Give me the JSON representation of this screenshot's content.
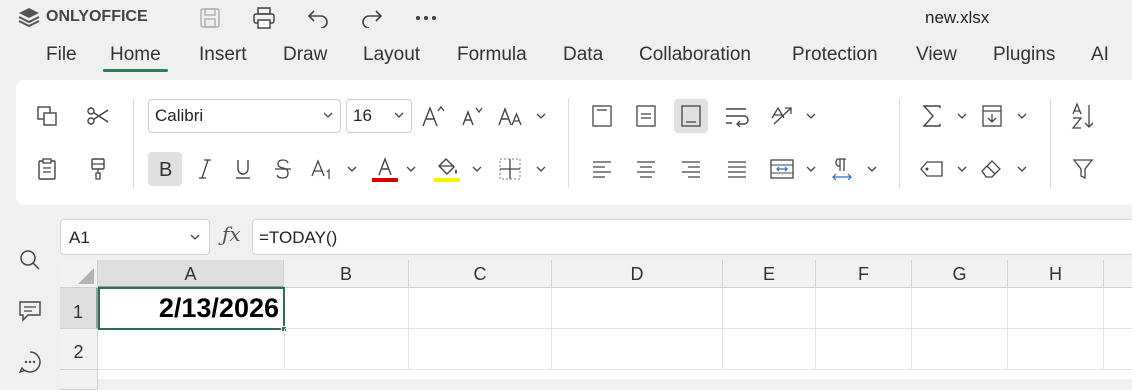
{
  "app": {
    "name": "ONLYOFFICE",
    "doc_title": "new.xlsx"
  },
  "quick_access": [
    "save-icon",
    "print-icon",
    "undo-icon",
    "redo-icon",
    "more-icon"
  ],
  "tabs": [
    {
      "label": "File"
    },
    {
      "label": "Home"
    },
    {
      "label": "Insert"
    },
    {
      "label": "Draw"
    },
    {
      "label": "Layout"
    },
    {
      "label": "Formula"
    },
    {
      "label": "Data"
    },
    {
      "label": "Collaboration"
    },
    {
      "label": "Protection"
    },
    {
      "label": "View"
    },
    {
      "label": "Plugins"
    },
    {
      "label": "AI"
    }
  ],
  "active_tab": "Home",
  "ribbon": {
    "font_name": "Calibri",
    "font_size": "16",
    "font_color": "#e00000",
    "highlight_color": "#f5f500"
  },
  "formula_bar": {
    "cell_ref": "A1",
    "formula": "=TODAY()"
  },
  "sheet": {
    "columns": [
      "A",
      "B",
      "C",
      "D",
      "E",
      "F",
      "G",
      "H"
    ],
    "rows": [
      "1",
      "2"
    ],
    "selected_cell": "A1",
    "cells": {
      "A1": "2/13/2026"
    }
  }
}
